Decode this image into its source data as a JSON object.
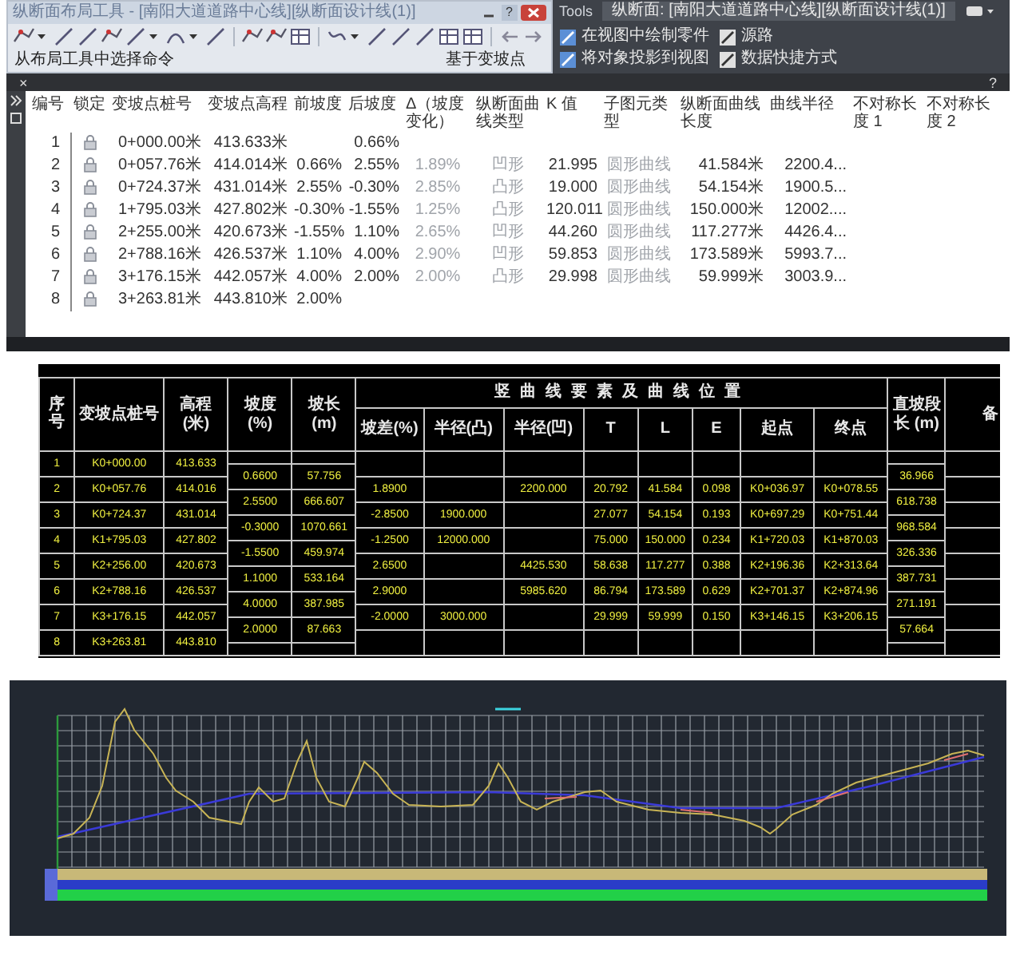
{
  "layout_toolbar": {
    "title": "纵断面布局工具 - [南阳大道道路中心线][纵断面设计线(1)]",
    "help": "?",
    "panel_labels": [
      "从布局工具中选择命令",
      "基于变坡点"
    ]
  },
  "ribbon": {
    "tab": "Tools",
    "context_title": "纵断面: [南阳大道道路中心线][纵断面设计线(1)]",
    "commands": [
      "在视图中绘制零件",
      "源路",
      "将对象投影到视图",
      "数据快捷方式"
    ]
  },
  "palette_bar": {
    "close": "×",
    "help": "?"
  },
  "pvi_table": {
    "columns": [
      {
        "label": "编号"
      },
      {
        "label": "锁定"
      },
      {
        "label": "变坡点桩号"
      },
      {
        "label": "变坡点高程"
      },
      {
        "label": "前坡度"
      },
      {
        "label": "后坡度"
      },
      {
        "label": "Δ（坡度变化）",
        "dimmed": true
      },
      {
        "label": "纵断面曲线类型",
        "dimmed": true
      },
      {
        "label": "K 值"
      },
      {
        "label": "子图元类型",
        "dimmed": true
      },
      {
        "label": "纵断面曲线长度"
      },
      {
        "label": "曲线半径"
      },
      {
        "label": "不对称长度 1"
      },
      {
        "label": "不对称长度 2"
      }
    ],
    "rows": [
      {
        "number": "1",
        "locked": true,
        "station": "0+000.00米",
        "elevation": "413.633米",
        "grade_out": "0.66%"
      },
      {
        "number": "2",
        "locked": true,
        "station": "0+057.76米",
        "elevation": "414.014米",
        "grade_in": "0.66%",
        "grade_out": "2.55%",
        "grade_change": "1.89%",
        "curve_type": "凹形",
        "k_value": "21.995",
        "subentity_type": "圆形曲线",
        "curve_length": "41.584米",
        "curve_radius": "2200.4..."
      },
      {
        "number": "3",
        "locked": true,
        "station": "0+724.37米",
        "elevation": "431.014米",
        "grade_in": "2.55%",
        "grade_out": "-0.30%",
        "grade_change": "2.85%",
        "curve_type": "凸形",
        "k_value": "19.000",
        "subentity_type": "圆形曲线",
        "curve_length": "54.154米",
        "curve_radius": "1900.5..."
      },
      {
        "number": "4",
        "locked": true,
        "station": "1+795.03米",
        "elevation": "427.802米",
        "grade_in": "-0.30%",
        "grade_out": "-1.55%",
        "grade_change": "1.25%",
        "curve_type": "凸形",
        "k_value": "120.011",
        "subentity_type": "圆形曲线",
        "curve_length": "150.000米",
        "curve_radius": "12002...."
      },
      {
        "number": "5",
        "locked": true,
        "station": "2+255.00米",
        "elevation": "420.673米",
        "grade_in": "-1.55%",
        "grade_out": "1.10%",
        "grade_change": "2.65%",
        "curve_type": "凹形",
        "k_value": "44.260",
        "subentity_type": "圆形曲线",
        "curve_length": "117.277米",
        "curve_radius": "4426.4..."
      },
      {
        "number": "6",
        "locked": true,
        "station": "2+788.16米",
        "elevation": "426.537米",
        "grade_in": "1.10%",
        "grade_out": "4.00%",
        "grade_change": "2.90%",
        "curve_type": "凹形",
        "k_value": "59.853",
        "subentity_type": "圆形曲线",
        "curve_length": "173.589米",
        "curve_radius": "5993.7..."
      },
      {
        "number": "7",
        "locked": true,
        "station": "3+176.15米",
        "elevation": "442.057米",
        "grade_in": "4.00%",
        "grade_out": "2.00%",
        "grade_change": "2.00%",
        "curve_type": "凸形",
        "k_value": "29.998",
        "subentity_type": "圆形曲线",
        "curve_length": "59.999米",
        "curve_radius": "3003.9..."
      },
      {
        "number": "8",
        "locked": true,
        "station": "3+263.81米",
        "elevation": "443.810米",
        "grade_in": "2.00%"
      }
    ]
  },
  "vertical_curve_table": {
    "headers": {
      "number": "序号",
      "station": "变坡点桩号",
      "elevation": "高程 (米)",
      "grade": "坡度 (%)",
      "grade_length": "坡长 (m)",
      "curve_group": "竖曲线要素及曲线位置",
      "grade_diff": "坡差(%)",
      "radius_convex": "半径(凸)",
      "radius_concave": "半径(凹)",
      "t": "T",
      "l": "L",
      "e": "E",
      "start": "起点",
      "end": "终点",
      "tangent_length": "直坡段长 (m)",
      "remark": "备"
    },
    "points": [
      {
        "number": "1",
        "station": "K0+000.00",
        "elevation": "413.633"
      },
      {
        "number": "2",
        "station": "K0+057.76",
        "elevation": "414.016",
        "curve": {
          "grade_diff": "1.8900",
          "radius_concave": "2200.000",
          "t": "20.792",
          "l": "41.584",
          "e": "0.098",
          "start": "K0+036.97",
          "end": "K0+078.55"
        }
      },
      {
        "number": "3",
        "station": "K0+724.37",
        "elevation": "431.014",
        "curve": {
          "grade_diff": "-2.8500",
          "radius_convex": "1900.000",
          "t": "27.077",
          "l": "54.154",
          "e": "0.193",
          "start": "K0+697.29",
          "end": "K0+751.44"
        }
      },
      {
        "number": "4",
        "station": "K1+795.03",
        "elevation": "427.802",
        "curve": {
          "grade_diff": "-1.2500",
          "radius_convex": "12000.000",
          "t": "75.000",
          "l": "150.000",
          "e": "0.234",
          "start": "K1+720.03",
          "end": "K1+870.03"
        }
      },
      {
        "number": "5",
        "station": "K2+256.00",
        "elevation": "420.673",
        "curve": {
          "grade_diff": "2.6500",
          "radius_concave": "4425.530",
          "t": "58.638",
          "l": "117.277",
          "e": "0.388",
          "start": "K2+196.36",
          "end": "K2+313.64"
        }
      },
      {
        "number": "6",
        "station": "K2+788.16",
        "elevation": "426.537",
        "curve": {
          "grade_diff": "2.9000",
          "radius_concave": "5985.620",
          "t": "86.794",
          "l": "173.589",
          "e": "0.629",
          "start": "K2+701.37",
          "end": "K2+874.96"
        }
      },
      {
        "number": "7",
        "station": "K3+176.15",
        "elevation": "442.057",
        "curve": {
          "grade_diff": "-2.0000",
          "radius_convex": "3000.000",
          "t": "29.999",
          "l": "59.999",
          "e": "0.150",
          "start": "K3+146.15",
          "end": "K3+206.15"
        }
      },
      {
        "number": "8",
        "station": "K3+263.81",
        "elevation": "443.810"
      }
    ],
    "grades": [
      {
        "grade": "0.6600",
        "length": "57.756",
        "tangent_length": "36.966"
      },
      {
        "grade": "2.5500",
        "length": "666.607",
        "tangent_length": "618.738"
      },
      {
        "grade": "-0.3000",
        "length": "1070.661",
        "tangent_length": "968.584"
      },
      {
        "grade": "-1.5500",
        "length": "459.974",
        "tangent_length": "326.336"
      },
      {
        "grade": "1.1000",
        "length": "533.164",
        "tangent_length": "387.731"
      },
      {
        "grade": "4.0000",
        "length": "387.985",
        "tangent_length": "271.191"
      },
      {
        "grade": "2.0000",
        "length": "87.663",
        "tangent_length": "57.664"
      }
    ]
  }
}
